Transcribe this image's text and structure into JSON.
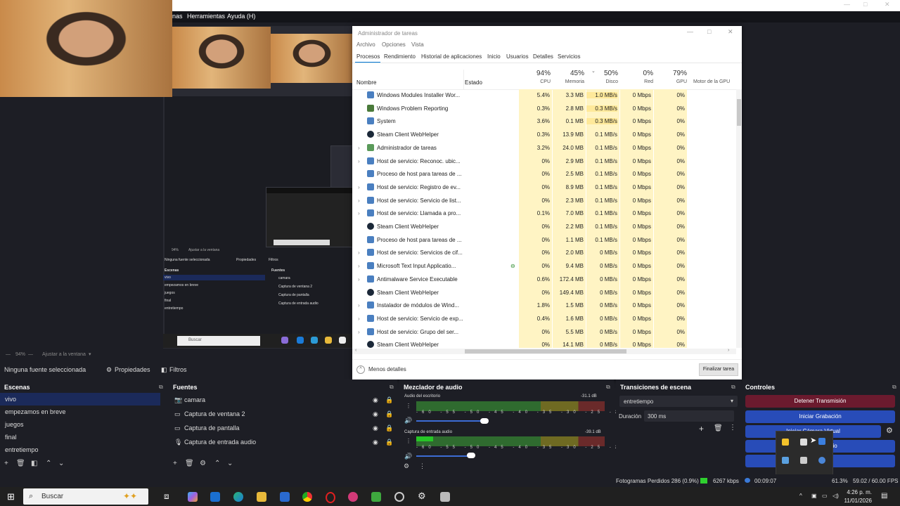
{
  "obs": {
    "menu": [
      "nas",
      "Herramientas",
      "Ayuda (H)"
    ],
    "zoom": "94%",
    "fit": "Ajustar a la ventana",
    "no_source": "Ninguna fuente seleccionada",
    "properties": "Propiedades",
    "filters": "Filtros"
  },
  "nested_preview": {
    "no_source": "Ninguna fuente seleccionada",
    "properties": "Propiedades",
    "filters": "Filtros",
    "scenes_title": "Escenas",
    "sources_title": "Fuentes",
    "scenes": [
      "vivo",
      "empezamos en breve",
      "juegos",
      "final",
      "entretiempo"
    ],
    "sources": [
      "camara",
      "Captura de ventana 2",
      "Captura de pantalla",
      "Captura de entrada audio"
    ],
    "search": "Buscar",
    "zoom": "94%",
    "fit": "Ajustar a la ventana"
  },
  "task_manager": {
    "title": "Administrador de tareas",
    "menu": [
      "Archivo",
      "Opciones",
      "Vista"
    ],
    "tabs": [
      "Procesos",
      "Rendimiento",
      "Historial de aplicaciones",
      "Inicio",
      "Usuarios",
      "Detalles",
      "Servicios"
    ],
    "headers": {
      "name": "Nombre",
      "status": "Estado",
      "cpu_pct": "94%",
      "cpu": "CPU",
      "mem_pct": "45%",
      "mem": "Memoria",
      "disk_pct": "50%",
      "disk": "Disco",
      "net_pct": "0%",
      "net": "Red",
      "gpu_pct": "79%",
      "gpu": "GPU",
      "gpu_engine": "Motor de la GPU"
    },
    "rows": [
      {
        "name": "Windows Modules Installer Wor...",
        "cpu": "5.4%",
        "mem": "3.3 MB",
        "disk": "1.0 MB/s",
        "net": "0 Mbps",
        "gpu": "0%",
        "expand": false,
        "icon": "app"
      },
      {
        "name": "Windows Problem Reporting",
        "cpu": "0.3%",
        "mem": "2.8 MB",
        "disk": "0.3 MB/s",
        "net": "0 Mbps",
        "gpu": "0%",
        "expand": false,
        "icon": "report"
      },
      {
        "name": "System",
        "cpu": "3.6%",
        "mem": "0.1 MB",
        "disk": "0.3 MB/s",
        "net": "0 Mbps",
        "gpu": "0%",
        "expand": false,
        "icon": "app"
      },
      {
        "name": "Steam Client WebHelper",
        "cpu": "0.3%",
        "mem": "13.9 MB",
        "disk": "0.1 MB/s",
        "net": "0 Mbps",
        "gpu": "0%",
        "expand": false,
        "icon": "steam"
      },
      {
        "name": "Administrador de tareas",
        "cpu": "3.2%",
        "mem": "24.0 MB",
        "disk": "0.1 MB/s",
        "net": "0 Mbps",
        "gpu": "0%",
        "expand": true,
        "icon": "taskmgr"
      },
      {
        "name": "Host de servicio: Reconoc. ubic...",
        "cpu": "0%",
        "mem": "2.9 MB",
        "disk": "0.1 MB/s",
        "net": "0 Mbps",
        "gpu": "0%",
        "expand": true,
        "icon": "app"
      },
      {
        "name": "Proceso de host para tareas de ...",
        "cpu": "0%",
        "mem": "2.5 MB",
        "disk": "0.1 MB/s",
        "net": "0 Mbps",
        "gpu": "0%",
        "expand": false,
        "icon": "app"
      },
      {
        "name": "Host de servicio: Registro de ev...",
        "cpu": "0%",
        "mem": "8.9 MB",
        "disk": "0.1 MB/s",
        "net": "0 Mbps",
        "gpu": "0%",
        "expand": true,
        "icon": "app"
      },
      {
        "name": "Host de servicio: Servicio de list...",
        "cpu": "0%",
        "mem": "2.3 MB",
        "disk": "0.1 MB/s",
        "net": "0 Mbps",
        "gpu": "0%",
        "expand": true,
        "icon": "app"
      },
      {
        "name": "Host de servicio: Llamada a pro...",
        "cpu": "0.1%",
        "mem": "7.0 MB",
        "disk": "0.1 MB/s",
        "net": "0 Mbps",
        "gpu": "0%",
        "expand": true,
        "icon": "app"
      },
      {
        "name": "Steam Client WebHelper",
        "cpu": "0%",
        "mem": "2.2 MB",
        "disk": "0.1 MB/s",
        "net": "0 Mbps",
        "gpu": "0%",
        "expand": false,
        "icon": "steam"
      },
      {
        "name": "Proceso de host para tareas de ...",
        "cpu": "0%",
        "mem": "1.1 MB",
        "disk": "0.1 MB/s",
        "net": "0 Mbps",
        "gpu": "0%",
        "expand": false,
        "icon": "app"
      },
      {
        "name": "Host de servicio: Servicios de cif...",
        "cpu": "0%",
        "mem": "2.0 MB",
        "disk": "0 MB/s",
        "net": "0 Mbps",
        "gpu": "0%",
        "expand": true,
        "icon": "app"
      },
      {
        "name": "Microsoft Text Input Applicatio...",
        "cpu": "0%",
        "mem": "9.4 MB",
        "disk": "0 MB/s",
        "net": "0 Mbps",
        "gpu": "0%",
        "expand": true,
        "icon": "app",
        "leaf": true
      },
      {
        "name": "Antimalware Service Executable",
        "cpu": "0.6%",
        "mem": "172.4 MB",
        "disk": "0 MB/s",
        "net": "0 Mbps",
        "gpu": "0%",
        "expand": true,
        "icon": "app"
      },
      {
        "name": "Steam Client WebHelper",
        "cpu": "0%",
        "mem": "149.4 MB",
        "disk": "0 MB/s",
        "net": "0 Mbps",
        "gpu": "0%",
        "expand": false,
        "icon": "steam"
      },
      {
        "name": "Instalador de módulos de Wind...",
        "cpu": "1.8%",
        "mem": "1.5 MB",
        "disk": "0 MB/s",
        "net": "0 Mbps",
        "gpu": "0%",
        "expand": true,
        "icon": "app"
      },
      {
        "name": "Host de servicio: Servicio de exp...",
        "cpu": "0.4%",
        "mem": "1.6 MB",
        "disk": "0 MB/s",
        "net": "0 Mbps",
        "gpu": "0%",
        "expand": true,
        "icon": "app"
      },
      {
        "name": "Host de servicio: Grupo del ser...",
        "cpu": "0%",
        "mem": "5.5 MB",
        "disk": "0 MB/s",
        "net": "0 Mbps",
        "gpu": "0%",
        "expand": true,
        "icon": "app"
      },
      {
        "name": "Steam Client WebHelper",
        "cpu": "0%",
        "mem": "14.1 MB",
        "disk": "0 MB/s",
        "net": "0 Mbps",
        "gpu": "0%",
        "expand": false,
        "icon": "steam"
      }
    ],
    "less_details": "Menos detalles",
    "end_task": "Finalizar tarea"
  },
  "scenes": {
    "title": "Escenas",
    "items": [
      "vivo",
      "empezamos en breve",
      "juegos",
      "final",
      "entretiempo"
    ],
    "selected": 0
  },
  "sources": {
    "title": "Fuentes",
    "items": [
      {
        "name": "camara",
        "icon": "camera-icon"
      },
      {
        "name": "Captura de ventana 2",
        "icon": "window-icon"
      },
      {
        "name": "Captura de pantalla",
        "icon": "monitor-icon"
      },
      {
        "name": "Captura de entrada audio",
        "icon": "mic-icon"
      }
    ]
  },
  "mixer": {
    "title": "Mezclador de audio",
    "channels": [
      {
        "name": "Audio del escritorio",
        "db": "-31.1 dB",
        "level": 0.0,
        "volume": 0.8
      },
      {
        "name": "Captura de entrada audio",
        "db": "-39.1 dB",
        "level": 0.09,
        "volume": 0.6
      }
    ],
    "ticks": [
      "-60",
      "-55",
      "-50",
      "-45",
      "-40",
      "-35",
      "-30",
      "-25",
      "-20",
      "-15",
      "-10",
      "-5",
      "0"
    ]
  },
  "transitions": {
    "title": "Transiciones de escena",
    "selected": "entretiempo",
    "duration_label": "Duración",
    "duration_value": "300 ms"
  },
  "controls": {
    "title": "Controles",
    "stop_stream": "Detener Transmisión",
    "start_record": "Iniciar Grabación",
    "virtual_cam": "Iniciar Cámara Virtual",
    "studio_fragment": "dio"
  },
  "status": {
    "dropped": "Fotogramas Perdidos 286 (0.9%)",
    "bitrate": "6267 kbps",
    "time": "00:09:07",
    "cpu": "61.3%",
    "fps": "59.02 / 60.00 FPS"
  },
  "taskbar": {
    "search": "Buscar",
    "time": "4:26 p. m.",
    "date": "11/01/2026"
  },
  "colors": {
    "stop_stream": "#6b1a2e",
    "accent_button": "#284cb8",
    "obs_bg": "#1d1e25",
    "tm_yellow": "#fff4c4",
    "tm_yellow_dark": "#ffe99a"
  }
}
